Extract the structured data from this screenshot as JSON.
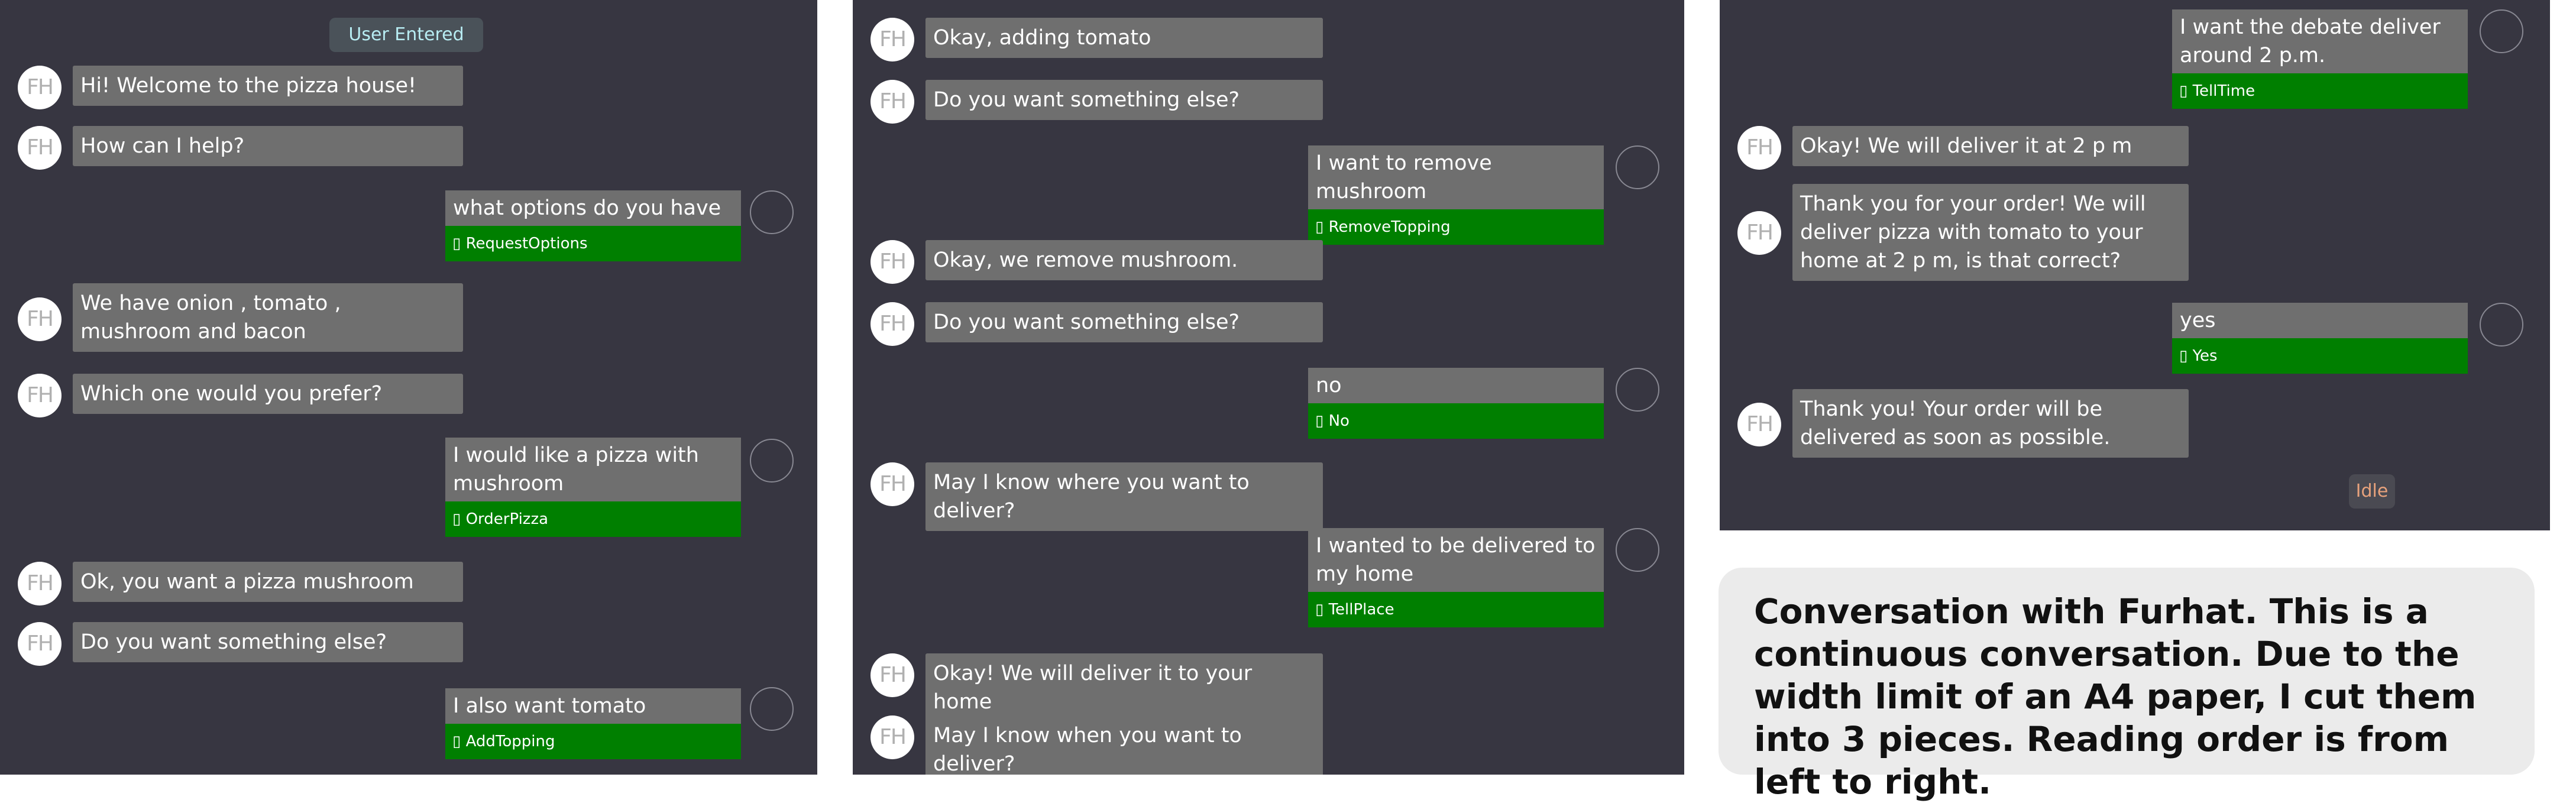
{
  "panel1": {
    "status": "User Entered",
    "robot_initials": "FH",
    "m1": "Hi! Welcome to the pizza house!",
    "m2": "How can I help?",
    "u1": {
      "text": "what options do you have",
      "intent": "▯ RequestOptions"
    },
    "m3": "We have onion , tomato , mushroom and bacon",
    "m4": "Which one would you prefer?",
    "u2": {
      "text": "I would like a pizza with mushroom",
      "intent": "▯ OrderPizza"
    },
    "m5": "Ok, you want a pizza mushroom",
    "m6": "Do you want something else?",
    "u3": {
      "text": "I also want tomato",
      "intent": "▯ AddTopping"
    }
  },
  "panel2": {
    "robot_initials": "FH",
    "m1": "Okay, adding tomato",
    "m2": "Do you want something else?",
    "u1": {
      "text": "I want to remove mushroom",
      "intent": "▯ RemoveTopping"
    },
    "m3": "Okay, we remove mushroom.",
    "m4": "Do you want something else?",
    "u2": {
      "text": "no",
      "intent": "▯ No"
    },
    "m5": "May I know where you want to deliver?",
    "u3": {
      "text": "I wanted to be delivered to my home",
      "intent": "▯ TellPlace"
    },
    "m6": "Okay! We will deliver it to your home",
    "m7": "May I know when you want to deliver?"
  },
  "panel3": {
    "robot_initials": "FH",
    "u1": {
      "text": "I want the debate deliver around 2 p.m.",
      "intent": "▯ TellTime"
    },
    "m1": "Okay! We will deliver it at 2 p m",
    "m2": "Thank you for your order! We will deliver pizza with tomato to your home at 2 p m, is that correct?",
    "u2": {
      "text": "yes",
      "intent": "▯ Yes"
    },
    "m3": "Thank you! Your order will be delivered as soon as possible.",
    "status": "Idle"
  },
  "caption": "Conversation with Furhat. This is a continuous conversation. Due to the width limit of an A4 paper, I cut them into 3 pieces. Reading order is from left to right.",
  "colors": {
    "panel_bg": "#373641",
    "bubble_bg": "#6f6f6f",
    "intent_bg": "#007f00",
    "caption_bg": "#ebebeb"
  }
}
